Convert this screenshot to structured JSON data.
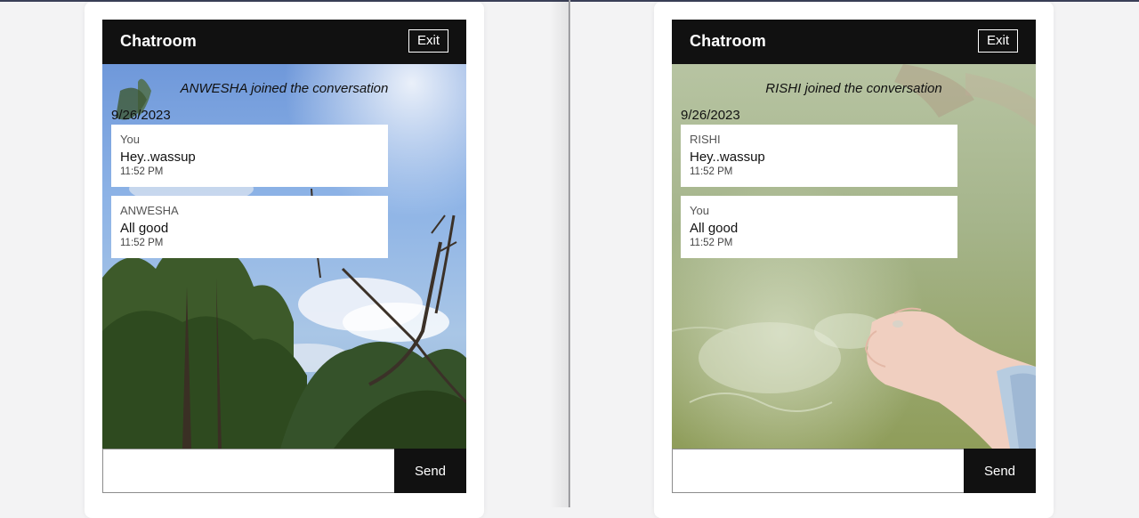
{
  "panes": [
    {
      "header": {
        "title": "Chatroom",
        "exit_label": "Exit"
      },
      "notice": "ANWESHA joined the conversation",
      "date": "9/26/2023",
      "messages": [
        {
          "author": "You",
          "text": "Hey..wassup",
          "time": "11:52 PM"
        },
        {
          "author": "ANWESHA",
          "text": "All good",
          "time": "11:52 PM"
        }
      ],
      "composer": {
        "value": "",
        "send_label": "Send"
      },
      "background": "sky-with-trees"
    },
    {
      "header": {
        "title": "Chatroom",
        "exit_label": "Exit"
      },
      "notice": "RISHI joined the conversation",
      "date": "9/26/2023",
      "messages": [
        {
          "author": "RISHI",
          "text": "Hey..wassup",
          "time": "11:52 PM"
        },
        {
          "author": "You",
          "text": "All good",
          "time": "11:52 PM"
        }
      ],
      "composer": {
        "value": "",
        "send_label": "Send"
      },
      "background": "hand-in-water"
    }
  ],
  "colors": {
    "header_bg": "#111111",
    "page_bg": "#f3f3f4",
    "bubble_bg": "#ffffff"
  }
}
